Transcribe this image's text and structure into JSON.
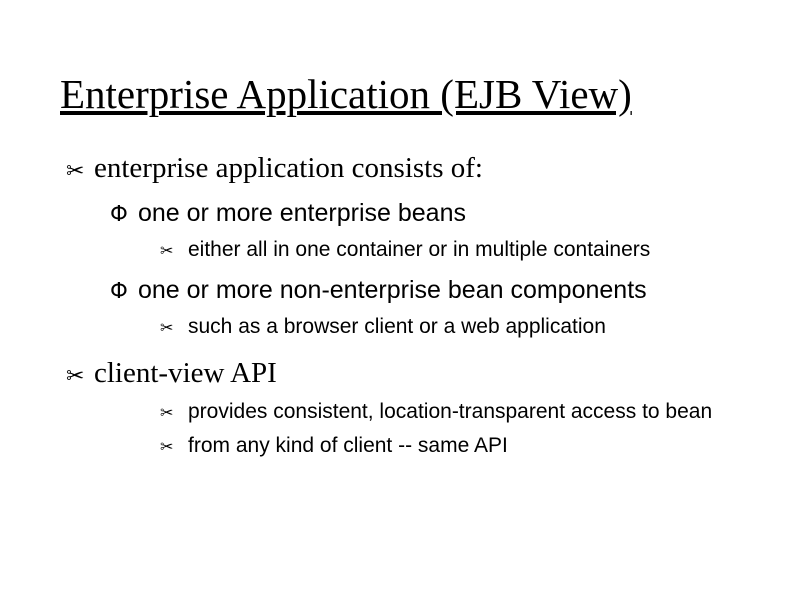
{
  "title": "Enterprise Application (EJB View)",
  "bullets": {
    "scissors": "✂",
    "tilde": "Փ"
  },
  "p1": {
    "text": "enterprise application consists of:",
    "c1": {
      "text": "one or more enterprise beans",
      "c1": {
        "text": "either all in one container or in multiple containers"
      }
    },
    "c2": {
      "text": "one or more non-enterprise bean components",
      "c1": {
        "text": "such as a browser client or a web application"
      }
    }
  },
  "p2": {
    "text": "client-view API",
    "c1": {
      "text": "provides consistent, location-transparent access to bean"
    },
    "c2": {
      "text": "from any kind of client -- same API"
    }
  }
}
